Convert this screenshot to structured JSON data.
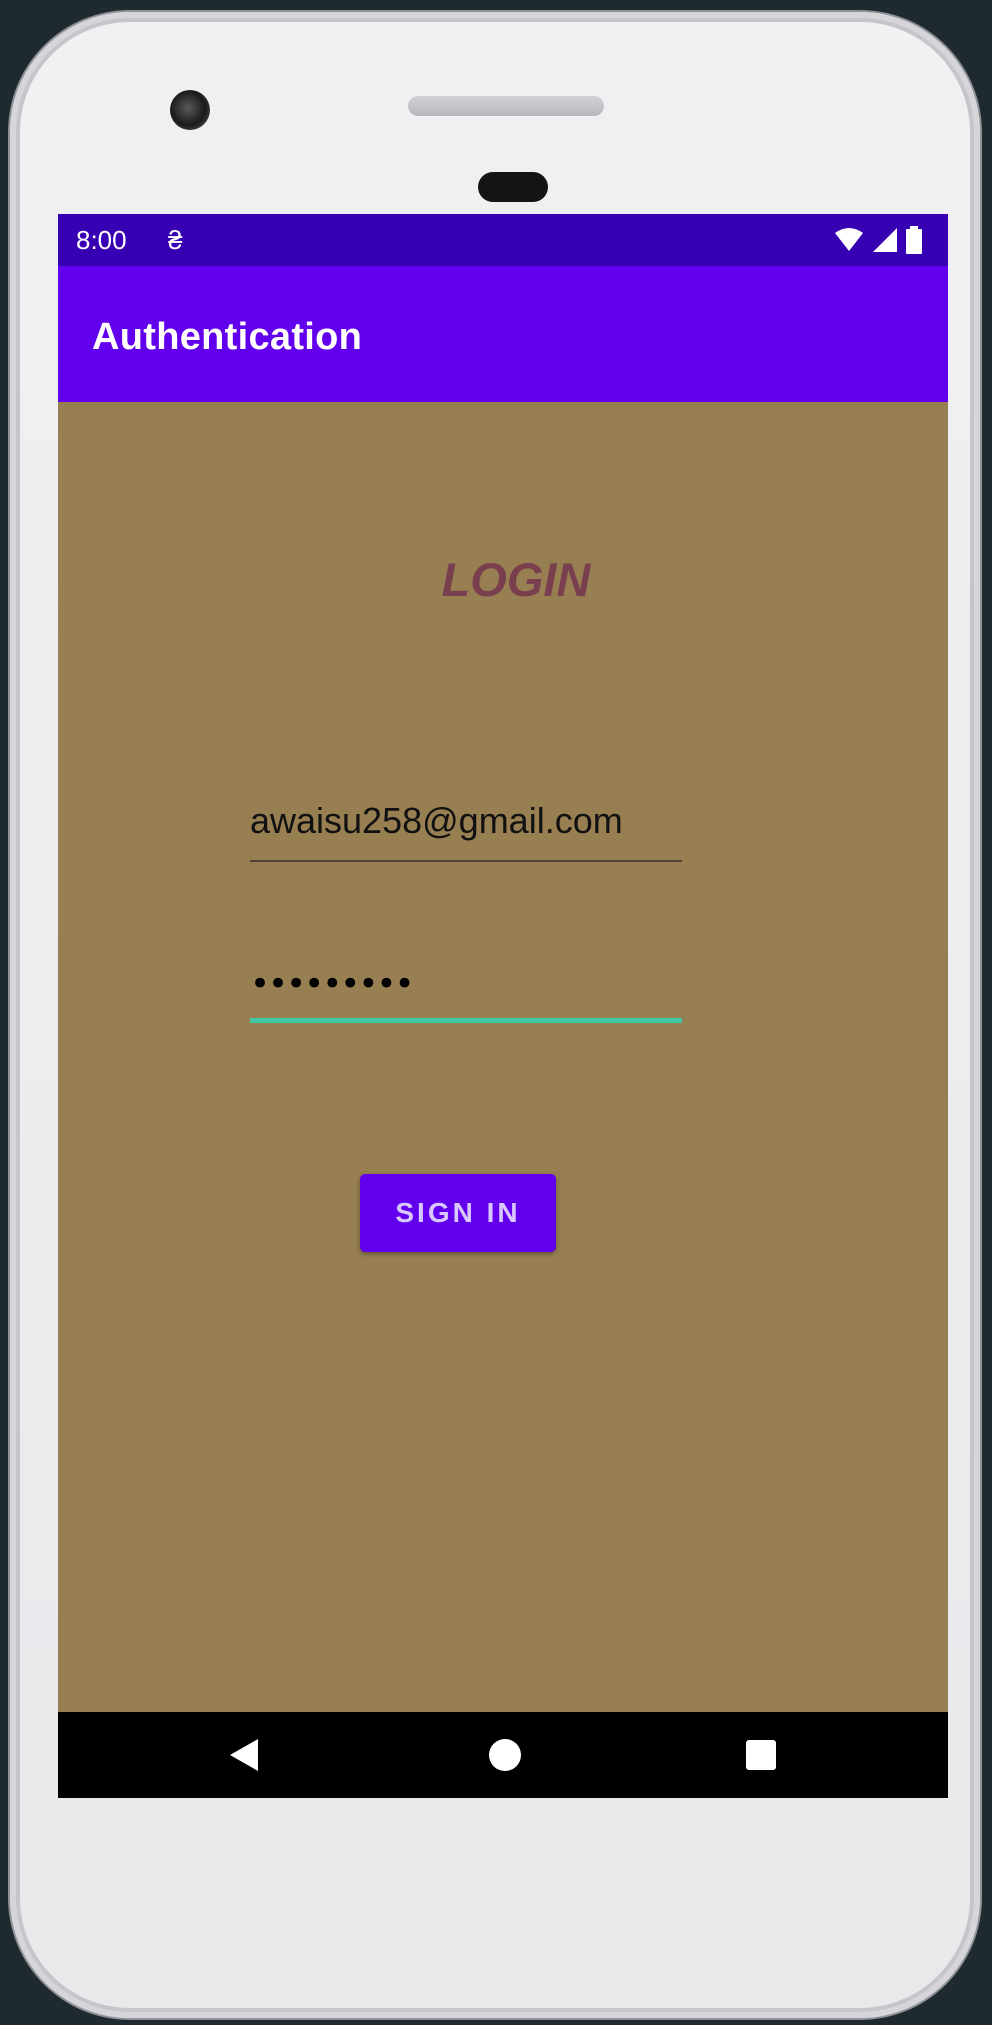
{
  "status_bar": {
    "time": "8:00",
    "notification_icon": "nfc-like-icon",
    "icons": [
      "wifi-icon",
      "cell-signal-icon",
      "battery-icon"
    ]
  },
  "app_bar": {
    "title": "Authentication"
  },
  "login": {
    "heading": "LOGIN",
    "email_value": "awaisu258@gmail.com",
    "password_value": "•••••••••",
    "sign_in_label": "SIGN IN"
  },
  "nav_bar": {
    "icons": [
      "back-icon",
      "home-icon",
      "recents-icon"
    ]
  },
  "colors": {
    "status_bar": "#3800b3",
    "app_bar": "#6200ee",
    "background": "#977f52",
    "heading": "#7a3f4f",
    "focus_underline": "#3fc7a6",
    "button": "#6200ee"
  }
}
